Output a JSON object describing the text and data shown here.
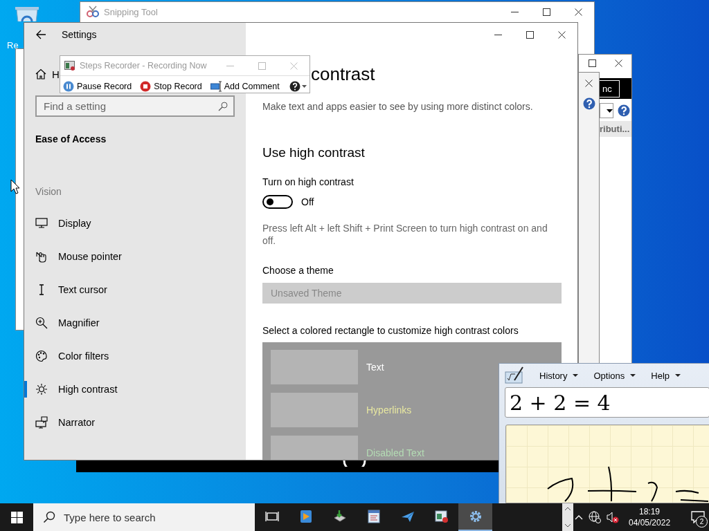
{
  "desktop": {
    "icon_label": "Re"
  },
  "snipping_tool": {
    "title": "Snipping Tool"
  },
  "back_window": {
    "header": "nc",
    "text": "ributi..."
  },
  "settings": {
    "title": "Settings",
    "home": "H",
    "search": {
      "placeholder": "Find a setting"
    },
    "section": "Ease of Access",
    "group": "Vision",
    "items": [
      {
        "label": "Display",
        "kind": "display",
        "selected": false
      },
      {
        "label": "Mouse pointer",
        "kind": "pointer",
        "selected": false
      },
      {
        "label": "Text cursor",
        "kind": "cursor",
        "selected": false
      },
      {
        "label": "Magnifier",
        "kind": "magnifier",
        "selected": false
      },
      {
        "label": "Color filters",
        "kind": "palette",
        "selected": false
      },
      {
        "label": "High contrast",
        "kind": "sun",
        "selected": true
      },
      {
        "label": "Narrator",
        "kind": "narrator",
        "selected": false
      }
    ],
    "page": {
      "heading": "contrast",
      "description": "Make text and apps easier to see by using more distinct colors.",
      "section_title": "Use high contrast",
      "toggle": {
        "label": "Turn on high contrast",
        "on": false,
        "state_text": "Off"
      },
      "hint": "Press left Alt + left Shift + Print Screen to turn high contrast on and off.",
      "theme": {
        "label": "Choose a theme",
        "value": "Unsaved Theme",
        "disabled": true
      },
      "colors_label": "Select a colored rectangle to customize high contrast colors",
      "swatches": [
        {
          "label": "Text",
          "color": "#ffffff"
        },
        {
          "label": "Hyperlinks",
          "color": "#e8e8a0"
        },
        {
          "label": "Disabled Text",
          "color": "#b4dcb4"
        }
      ]
    }
  },
  "steps_recorder": {
    "title": "Steps Recorder - Recording Now",
    "buttons": [
      {
        "label": "Pause Record",
        "kind": "pause"
      },
      {
        "label": "Stop Record",
        "kind": "stop"
      },
      {
        "label": "Add Comment",
        "kind": "comment"
      }
    ]
  },
  "math_input": {
    "menus": [
      {
        "label": "History"
      },
      {
        "label": "Options"
      },
      {
        "label": "Help"
      }
    ],
    "result": "2 + 2 = 4"
  },
  "taskbar": {
    "search_placeholder": "Type here to search",
    "apps": [
      {
        "kind": "taskview",
        "active": false
      },
      {
        "kind": "media",
        "active": false
      },
      {
        "kind": "install",
        "active": false
      },
      {
        "kind": "document",
        "active": false
      },
      {
        "kind": "mail",
        "active": false
      },
      {
        "kind": "snip",
        "active": false
      },
      {
        "kind": "settings",
        "active": true
      }
    ],
    "time": "18:19",
    "date": "04/05/2022",
    "notifications": "2"
  }
}
